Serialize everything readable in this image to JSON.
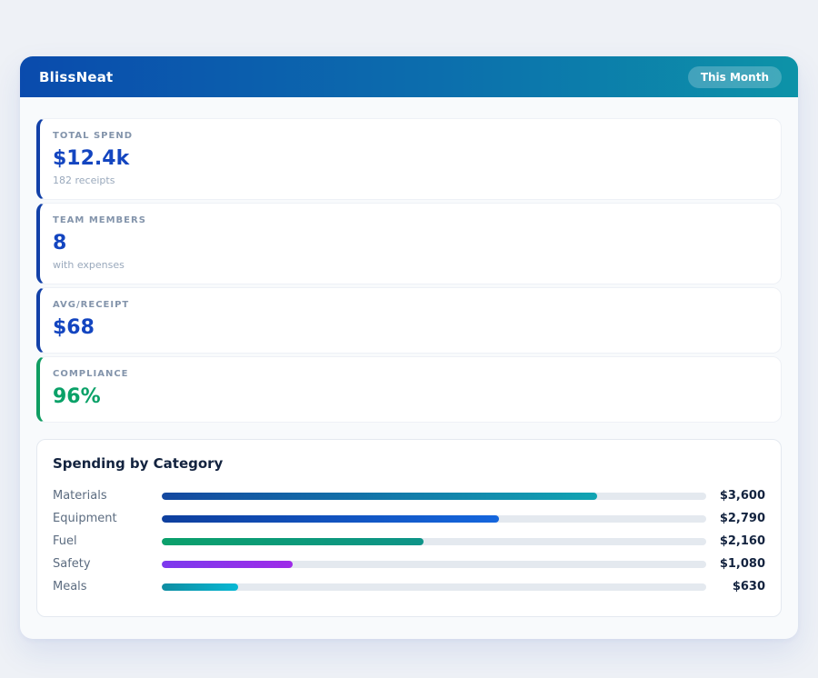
{
  "header": {
    "title": "BlissNeat",
    "badge": "This Month",
    "gradient_from": "#0a4bad",
    "gradient_to": "#0d93a8"
  },
  "stats": [
    {
      "label": "TOTAL SPEND",
      "value": "$12.4k",
      "sub": "182 receipts",
      "accent": "#1240a8",
      "value_color": "#1345c0"
    },
    {
      "label": "TEAM MEMBERS",
      "value": "8",
      "sub": "with expenses",
      "accent": "#1240a8",
      "value_color": "#1345c0"
    },
    {
      "label": "AVG/RECEIPT",
      "value": "$68",
      "sub": "",
      "accent": "#1240a8",
      "value_color": "#1345c0"
    },
    {
      "label": "COMPLIANCE",
      "value": "96%",
      "sub": "",
      "accent": "#0f9d62",
      "value_color": "#0aa168"
    }
  ],
  "category_section": {
    "title": "Spending by Category",
    "rows": [
      {
        "label": "Materials",
        "value": "$3,600",
        "pct": 80,
        "from": "#1448a0",
        "to": "#11a4b2"
      },
      {
        "label": "Equipment",
        "value": "$2,790",
        "pct": 62,
        "from": "#0e3f9e",
        "to": "#1566dd"
      },
      {
        "label": "Fuel",
        "value": "$2,160",
        "pct": 48,
        "from": "#0ba06b",
        "to": "#0e9488"
      },
      {
        "label": "Safety",
        "value": "$1,080",
        "pct": 24,
        "from": "#7c3aed",
        "to": "#9e2be8"
      },
      {
        "label": "Meals",
        "value": "$630",
        "pct": 14,
        "from": "#0e8da2",
        "to": "#08b8d4"
      }
    ],
    "track_color": "#e4e9ef"
  },
  "chart_data": {
    "type": "bar",
    "orientation": "horizontal",
    "title": "Spending by Category",
    "categories": [
      "Materials",
      "Equipment",
      "Fuel",
      "Safety",
      "Meals"
    ],
    "values": [
      3600,
      2790,
      2160,
      1080,
      630
    ],
    "value_labels": [
      "$3,600",
      "$2,790",
      "$2,160",
      "$1,080",
      "$630"
    ],
    "xlabel": "",
    "ylabel": "",
    "xlim": [
      0,
      4500
    ],
    "grid": false,
    "legend": false
  }
}
